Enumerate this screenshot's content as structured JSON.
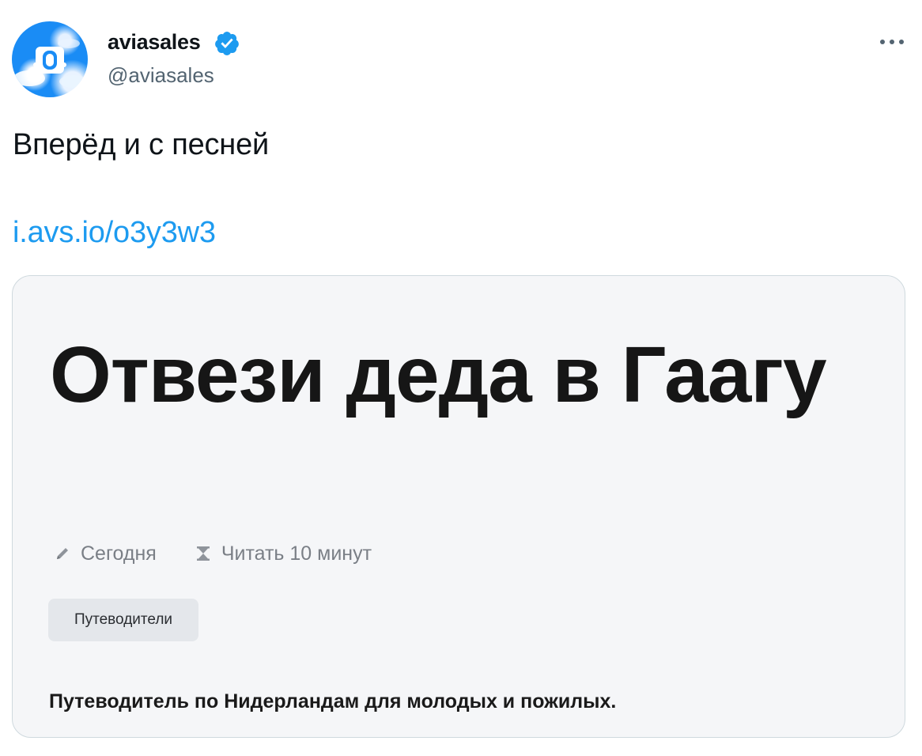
{
  "tweet": {
    "author": {
      "name": "aviasales",
      "handle": "@aviasales",
      "verified": true,
      "avatar_icon": "aviasales-logo-icon"
    },
    "more_icon": "more-dots-icon",
    "text": "Вперёд и с песней",
    "link_text": "i.avs.io/o3y3w3"
  },
  "card": {
    "title": "Отвези деда в Гаагу",
    "meta": {
      "date_icon": "pencil-icon",
      "date": "Сегодня",
      "read_icon": "hourglass-icon",
      "read_time": "Читать 10 минут"
    },
    "tag": "Путеводители",
    "description": "Путеводитель по Нидерландам для молодых и пожилых."
  },
  "colors": {
    "link": "#1d9bf0",
    "verified_badge": "#1d9bf0",
    "handle": "#536471",
    "card_background": "#f5f6f8",
    "tag_background": "#e4e7eb",
    "avatar_background": "#1a8cf5"
  }
}
